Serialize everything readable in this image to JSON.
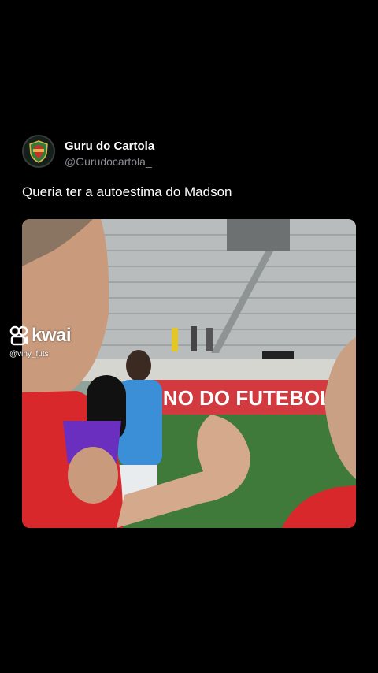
{
  "author": {
    "name": "Guru do Cartola",
    "handle": "@Gurudocartola_",
    "avatar_icon": "guru-shield-logo-icon"
  },
  "tweet": {
    "text": "Queria ter a autoestima do Madson"
  },
  "media": {
    "banner_text": "TINO DO FUTEBOL",
    "watermark": {
      "brand": "kwai",
      "user": "@viny_futs"
    }
  }
}
